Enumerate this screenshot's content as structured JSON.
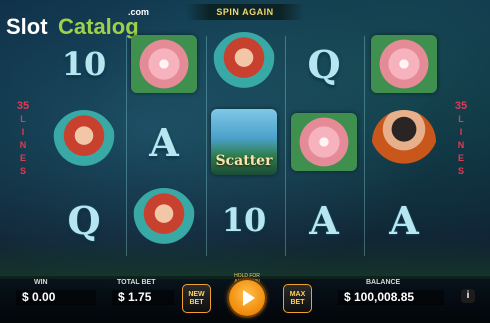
{
  "logo": {
    "part1": "Slot",
    "part2": "Catalog",
    "suffix": ".com"
  },
  "banner": "SPIN AGAIN",
  "lines_indicator": {
    "number": "35",
    "letters": [
      "L",
      "I",
      "N",
      "E",
      "S"
    ]
  },
  "reels": [
    [
      {
        "type": "letter",
        "text": "10"
      },
      {
        "type": "mermaid",
        "icon": "mermaid-icon"
      },
      {
        "type": "letter",
        "text": "Q"
      }
    ],
    [
      {
        "type": "flower",
        "icon": "lotus-flower-icon"
      },
      {
        "type": "letter",
        "text": "A"
      },
      {
        "type": "mermaid",
        "icon": "mermaid-icon"
      }
    ],
    [
      {
        "type": "mermaid",
        "icon": "mermaid-icon"
      },
      {
        "type": "scatter",
        "text": "Scatter",
        "icon": "scatter-island-icon"
      },
      {
        "type": "letter",
        "text": "10"
      }
    ],
    [
      {
        "type": "letter",
        "text": "Q"
      },
      {
        "type": "flower",
        "icon": "lotus-flower-icon"
      },
      {
        "type": "letter",
        "text": "A"
      }
    ],
    [
      {
        "type": "flower",
        "icon": "lotus-flower-icon"
      },
      {
        "type": "pirate",
        "icon": "pirate-icon"
      },
      {
        "type": "letter",
        "text": "A"
      }
    ]
  ],
  "bottom": {
    "win_label": "WIN",
    "win_value": "$ 0.00",
    "total_bet_label": "TOTAL BET",
    "total_bet_value": "$ 1.75",
    "new_bet": [
      "NEW",
      "BET"
    ],
    "hold_text": "HOLD FOR AUTOSPIN",
    "max_bet": [
      "MAX",
      "BET"
    ],
    "balance_label": "BALANCE",
    "balance_value": "$ 100,008.85",
    "info": "i"
  },
  "colors": {
    "accent": "#f08a0a",
    "lines": "#e03a55",
    "banner_text": "#f1d670",
    "logo_green": "#9dd14a"
  }
}
